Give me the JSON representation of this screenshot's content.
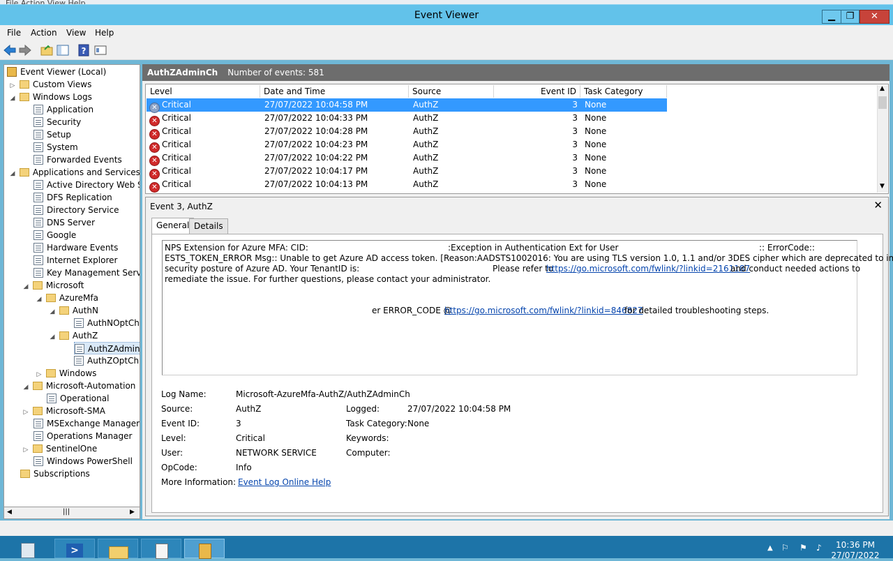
{
  "background_menu": "File   Action   View   Help",
  "window": {
    "title": "Event Viewer",
    "minimize": "▁",
    "restore": "❐",
    "close": "✕"
  },
  "menu": [
    "File",
    "Action",
    "View",
    "Help"
  ],
  "tree": {
    "root": "Event Viewer (Local)",
    "custom_views": "Custom Views",
    "windows_logs": "Windows Logs",
    "application": "Application",
    "security": "Security",
    "setup": "Setup",
    "system": "System",
    "forwarded_events": "Forwarded Events",
    "apps_services": "Applications and Services Lo",
    "active_directory": "Active Directory Web Ser",
    "dfs_replication": "DFS Replication",
    "directory_service": "Directory Service",
    "dns_server": "DNS Server",
    "google": "Google",
    "hardware_events": "Hardware Events",
    "internet_explorer": "Internet Explorer",
    "key_management": "Key Management Service",
    "microsoft": "Microsoft",
    "azuremfa": "AzureMfa",
    "authn": "AuthN",
    "authnoptch": "AuthNOptCh",
    "authz": "AuthZ",
    "authzadmin": "AuthZAdminC",
    "authzoptch": "AuthZOptCh",
    "windows": "Windows",
    "ms_automation": "Microsoft-Automation",
    "operational": "Operational",
    "ms_sma": "Microsoft-SMA",
    "msexchange": "MSExchange Manageme",
    "ops_manager": "Operations Manager",
    "sentinelone": "SentinelOne",
    "powershell": "Windows PowerShell",
    "subscriptions": "Subscriptions"
  },
  "log_header": {
    "name": "AuthZAdminCh",
    "count": "Number of events: 581"
  },
  "columns": [
    "Level",
    "Date and Time",
    "Source",
    "Event ID",
    "Task Category"
  ],
  "events": [
    {
      "level": "Critical",
      "date": "27/07/2022 10:04:58 PM",
      "source": "AuthZ",
      "id": "3",
      "task": "None"
    },
    {
      "level": "Critical",
      "date": "27/07/2022 10:04:33 PM",
      "source": "AuthZ",
      "id": "3",
      "task": "None"
    },
    {
      "level": "Critical",
      "date": "27/07/2022 10:04:28 PM",
      "source": "AuthZ",
      "id": "3",
      "task": "None"
    },
    {
      "level": "Critical",
      "date": "27/07/2022 10:04:23 PM",
      "source": "AuthZ",
      "id": "3",
      "task": "None"
    },
    {
      "level": "Critical",
      "date": "27/07/2022 10:04:22 PM",
      "source": "AuthZ",
      "id": "3",
      "task": "None"
    },
    {
      "level": "Critical",
      "date": "27/07/2022 10:04:17 PM",
      "source": "AuthZ",
      "id": "3",
      "task": "None"
    },
    {
      "level": "Critical",
      "date": "27/07/2022 10:04:13 PM",
      "source": "AuthZ",
      "id": "3",
      "task": "None"
    }
  ],
  "detail": {
    "title": "Event 3, AuthZ",
    "tab_general": "General",
    "tab_details": "Details",
    "msg_l1a": "NPS Extension for Azure MFA:  CID:",
    "msg_l1b": ":Exception in Authentication Ext for User",
    "msg_l1c": ":: ErrorCode::",
    "msg_l2": "ESTS_TOKEN_ERROR Msg:: Unable to get Azure AD access token. [Reason:AADSTS1002016: You are using TLS version 1.0, 1.1 and/or 3DES cipher which are deprecated to improve the",
    "msg_l3a": "security posture of Azure AD. Your TenantID is:",
    "msg_l3b": "Please refer to",
    "msg_l3_link": "https://go.microsoft.com/fwlink/?linkid=2161187",
    "msg_l3c": "and conduct needed actions to",
    "msg_l4": "remediate the issue. For further questions, please contact your administrator.",
    "msg_l6a": "er ERROR_CODE @",
    "msg_l6_link": "https://go.microsoft.com/fwlink/?linkid=846827",
    "msg_l6b": "for detailed troubleshooting steps.",
    "labels": {
      "log_name": "Log Name:",
      "source": "Source:",
      "event_id": "Event ID:",
      "level": "Level:",
      "user": "User:",
      "opcode": "OpCode:",
      "more_info": "More Information:",
      "logged": "Logged:",
      "task_category": "Task Category:",
      "keywords": "Keywords:",
      "computer": "Computer:"
    },
    "values": {
      "log_name": "Microsoft-AzureMfa-AuthZ/AuthZAdminCh",
      "source": "AuthZ",
      "event_id": "3",
      "level": "Critical",
      "user": "NETWORK SERVICE",
      "opcode": "Info",
      "more_info_link": "Event Log Online Help",
      "logged": "27/07/2022 10:04:58 PM",
      "task_category": "None"
    }
  },
  "taskbar": {
    "time": "10:36 PM",
    "date": "27/07/2022"
  }
}
